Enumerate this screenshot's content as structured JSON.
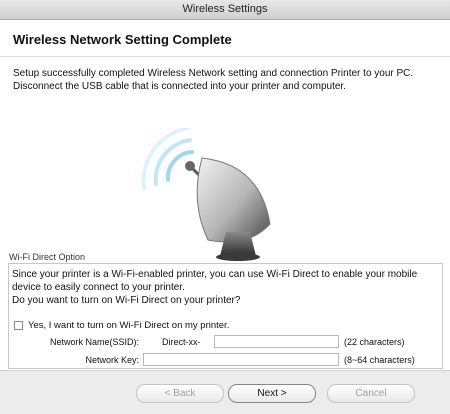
{
  "window": {
    "title": "Wireless Settings"
  },
  "page": {
    "heading": "Wireless Network Setting Complete",
    "description": "Setup successfully completed Wireless Network setting and connection Printer to your PC. Disconnect the USB cable that is connected into your printer and computer.",
    "illustration_icon": "satellite-dish-icon"
  },
  "wifi_direct": {
    "section_label": "Wi-Fi Direct Option",
    "intro": "Since your printer is a Wi-Fi-enabled printer, you can use Wi-Fi Direct to enable your mobile device to easily connect to your printer.",
    "question": "Do you want to turn on Wi-Fi Direct on your printer?",
    "checkbox_label": "Yes, I want to turn on Wi-Fi Direct on my printer.",
    "checkbox_checked": false,
    "ssid_label": "Network Name(SSID):",
    "ssid_prefix": "Direct-xx-",
    "ssid_value": "",
    "ssid_hint": "(22 characters)",
    "key_label": "Network Key:",
    "key_value": "",
    "key_hint": "(8~64 characters)"
  },
  "buttons": {
    "back": "< Back",
    "next": "Next >",
    "cancel": "Cancel"
  }
}
